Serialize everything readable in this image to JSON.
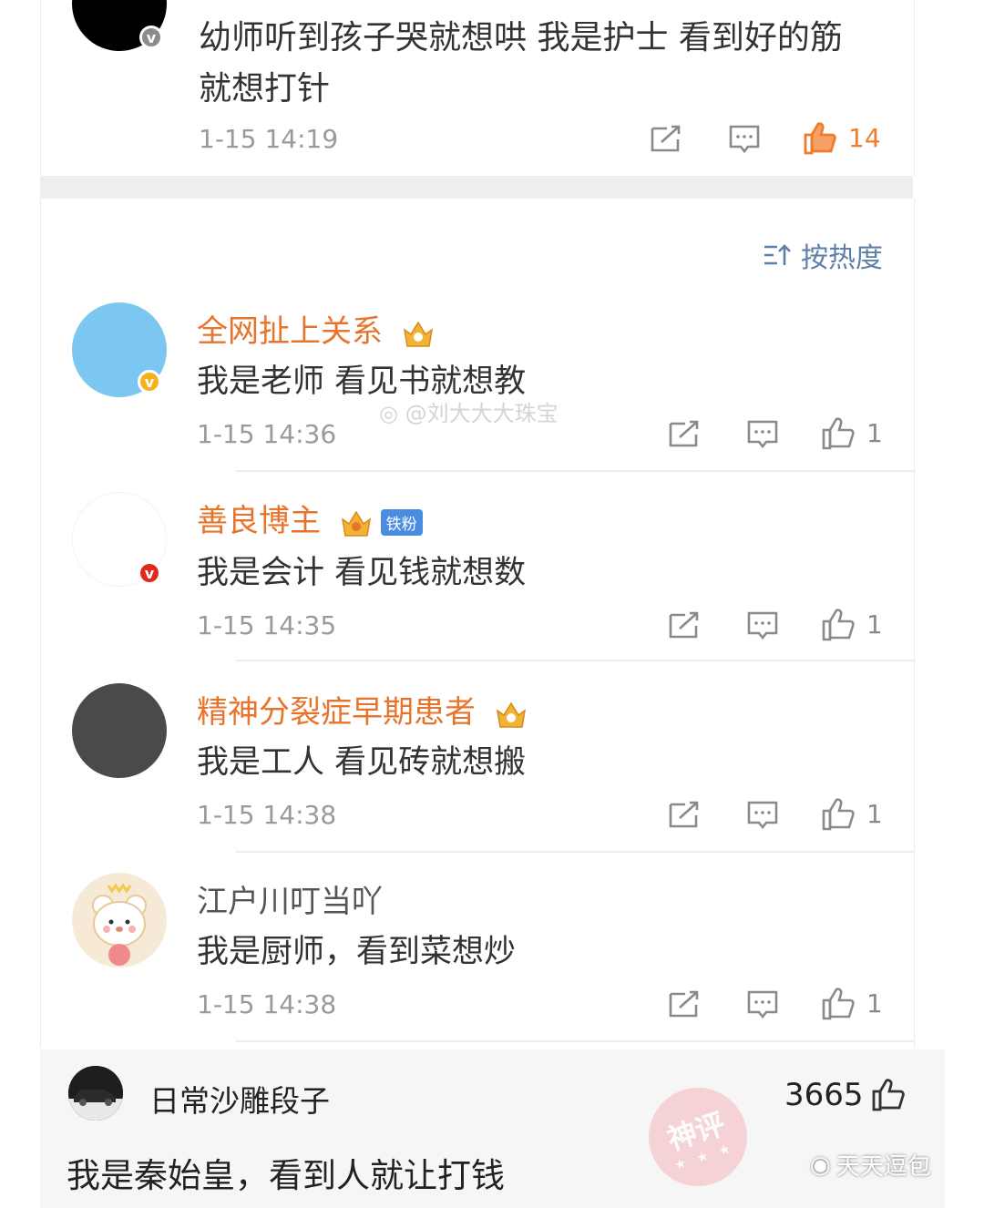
{
  "top_comment": {
    "text_line1": "幼师听到孩子哭就想哄 我是护士 看到好的筋",
    "text_line2": "就想打针",
    "time": "1-15 14:19",
    "likes": "14"
  },
  "sort": {
    "label": "按热度"
  },
  "comments": [
    {
      "username": "全网扯上关系",
      "text": "我是老师 看见书就想教",
      "time": "1-15 14:36",
      "likes": "1"
    },
    {
      "username": "善良博主",
      "badge": "铁粉",
      "text": "我是会计 看见钱就想数",
      "time": "1-15 14:35",
      "likes": "1"
    },
    {
      "username": "精神分裂症早期患者",
      "text": "我是工人 看见砖就想搬",
      "time": "1-15 14:38",
      "likes": "1"
    },
    {
      "username": "江户川叮当吖",
      "text": "我是厨师，看到菜想炒",
      "time": "1-15 14:38",
      "likes": "1"
    }
  ],
  "watermark": "@刘大大大珠宝",
  "bottom": {
    "username": "日常沙雕段子",
    "likes": "3665",
    "text": "我是秦始皇，看到人就让打钱",
    "stamp": "神评",
    "stamp_stars": "★ ★ ★",
    "source": "天天逗包"
  },
  "colors": {
    "username": "#e8742b",
    "liked": "#f07c2b",
    "link": "#5f7fa8"
  }
}
